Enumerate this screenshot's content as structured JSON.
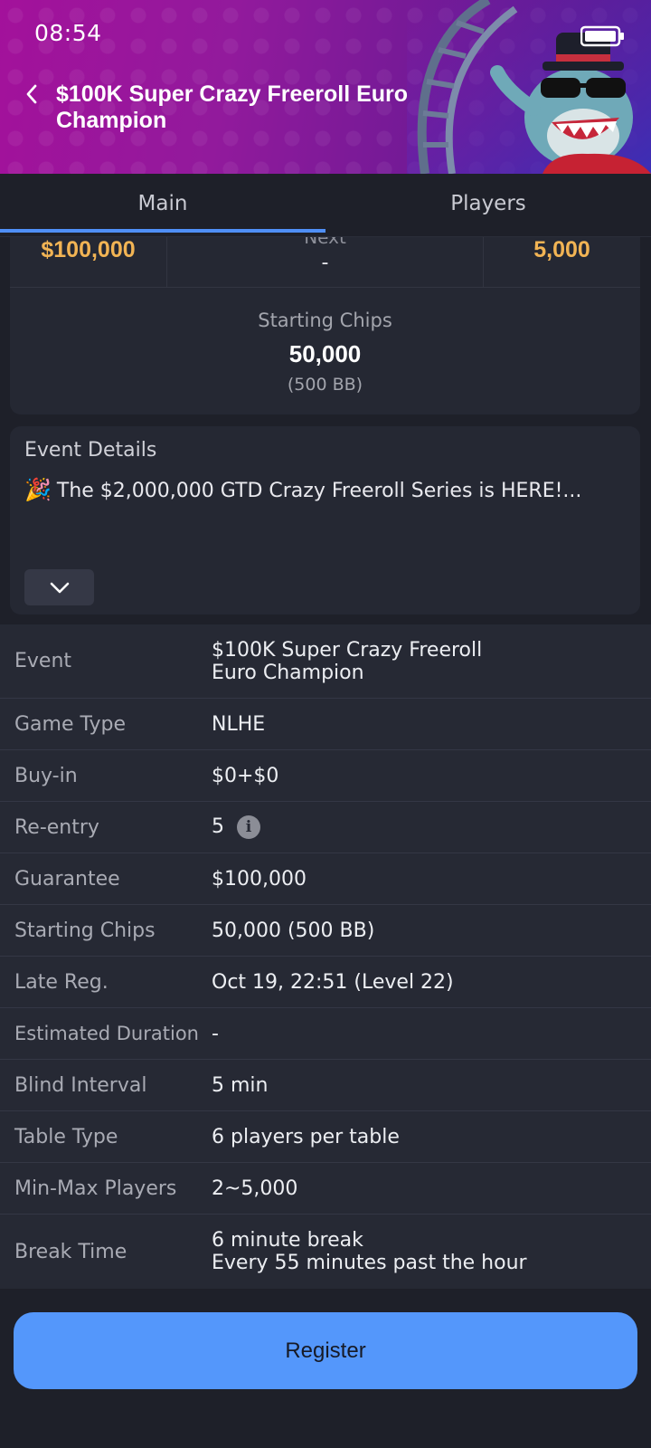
{
  "status_bar": {
    "time": "08:54"
  },
  "header": {
    "title": "$100K Super Crazy Freeroll Euro Champion"
  },
  "tabs": [
    {
      "label": "Main",
      "active": true
    },
    {
      "label": "Players",
      "active": false
    }
  ],
  "stats": {
    "prize": "$100,000",
    "next_label": "Next",
    "next_value": "-",
    "right_value": "5,000",
    "starting_chips_label": "Starting Chips",
    "starting_chips_value": "50,000",
    "starting_chips_bb": "(500 BB)"
  },
  "event_details": {
    "title": "Event Details",
    "emoji": "🎉",
    "text": "The $2,000,000 GTD Crazy Freeroll Series is HERE!..."
  },
  "info": {
    "event": {
      "key": "Event",
      "value": "$100K Super Crazy Freeroll Euro Champion"
    },
    "game_type": {
      "key": "Game Type",
      "value": "NLHE"
    },
    "buy_in": {
      "key": "Buy-in",
      "value": "$0+$0"
    },
    "re_entry": {
      "key": "Re-entry",
      "value": "5",
      "icon": "i"
    },
    "guarantee": {
      "key": "Guarantee",
      "value": "$100,000"
    },
    "starting_chips": {
      "key": "Starting Chips",
      "value": "50,000 (500 BB)"
    },
    "late_reg": {
      "key": "Late Reg.",
      "value": "Oct 19, 22:51 (Level 22)"
    },
    "estimated_duration": {
      "key": "Estimated Duration",
      "value": "-"
    },
    "blind_interval": {
      "key": "Blind Interval",
      "value": "5 min"
    },
    "table_type": {
      "key": "Table Type",
      "value": "6 players per table"
    },
    "min_max_players": {
      "key": "Min-Max Players",
      "value": "2~5,000"
    },
    "break_time": {
      "key": "Break Time",
      "value_line1": "6 minute break",
      "value_line2": "Every 55 minutes past the hour"
    }
  },
  "register": {
    "label": "Register"
  },
  "colors": {
    "accent": "#5497fb",
    "gold": "#f2b454",
    "background": "#1e2029",
    "header_gradient_start": "#a3119b",
    "header_gradient_end": "#4b1a8a"
  }
}
